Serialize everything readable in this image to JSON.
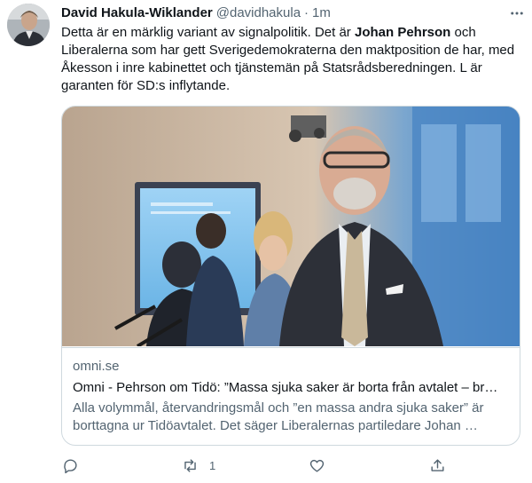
{
  "tweet": {
    "author_name": "David Hakula-Wiklander",
    "handle": "@davidhakula",
    "separator": "·",
    "time": "1m",
    "text": {
      "part1": "Detta är en märklig variant av signalpolitik. Det är ",
      "bold": "Johan Pehrson",
      "part2": " och Liberalerna som har gett Sverigedemokraterna den maktposition de har, med Åkesson i inre kabinettet och tjänstemän på Statsrådsberedningen. L är garanten för SD:s inflytande."
    }
  },
  "card": {
    "domain": "omni.se",
    "title": "Omni - Pehrson om Tidö: ”Massa sjuka saker är borta från avtalet – br…",
    "description": "Alla volymmål, återvandringsmål och ”en massa andra sjuka saker” är borttagna ur Tidöavtalet. Det säger Liberalernas partiledare Johan …"
  },
  "actions": {
    "reply_count": "",
    "retweet_count": "1",
    "like_count": "",
    "icons": [
      "reply-icon",
      "retweet-icon",
      "like-icon",
      "share-icon"
    ]
  },
  "colors": {
    "text_primary": "#0f1419",
    "text_secondary": "#536471",
    "border": "#cfd9de"
  }
}
